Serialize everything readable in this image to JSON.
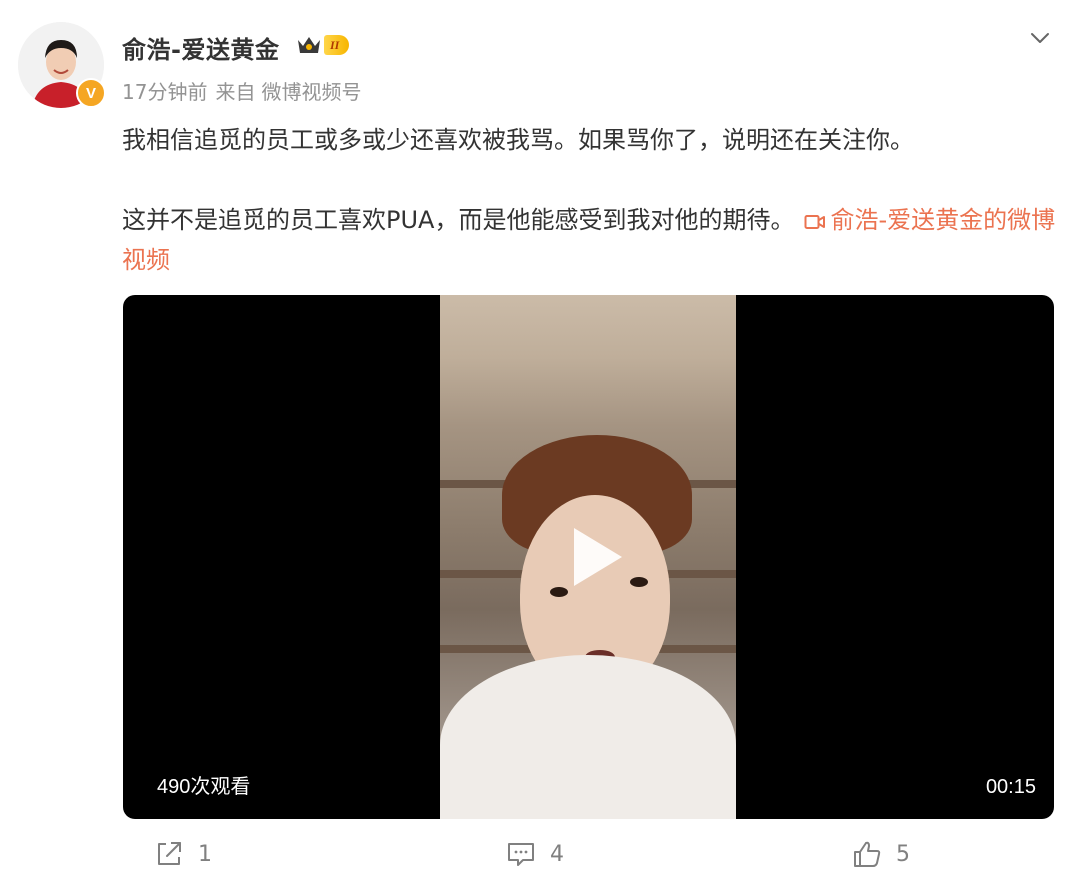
{
  "post": {
    "author": "俞浩-爱送黄金",
    "level_badge": "II",
    "verified_mark": "V",
    "time": "17分钟前",
    "source_prefix": "来自",
    "source": "微博视频号",
    "paragraph1": "我相信追觅的员工或多或少还喜欢被我骂。如果骂你了，说明还在关注你。",
    "paragraph2": "这并不是追觅的员工喜欢PUA，而是他能感受到我对他的期待。",
    "video_link": "俞浩-爱送黄金的微博视频"
  },
  "video": {
    "views": "490次观看",
    "duration": "00:15"
  },
  "actions": {
    "repost_count": "1",
    "comment_count": "4",
    "like_count": "5"
  },
  "icons": {
    "repost": "share-icon",
    "comment": "comment-icon",
    "like": "thumbs-up-icon",
    "video_link": "video-camera-icon",
    "play": "play-icon",
    "more": "chevron-down-icon"
  },
  "colors": {
    "link": "#eb7350",
    "meta": "#939393",
    "text": "#333333",
    "verified": "#f5a623"
  }
}
